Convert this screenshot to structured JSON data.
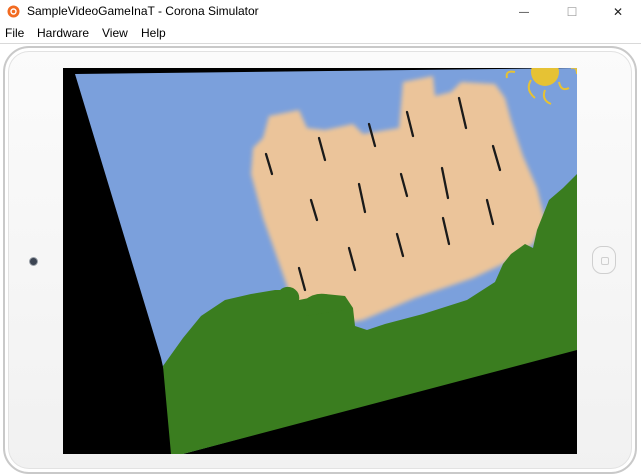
{
  "window": {
    "title": "SampleVideoGameInaT - Corona Simulator",
    "minimize_glyph": "—",
    "maximize_glyph": "☐",
    "close_glyph": "✕"
  },
  "menu": {
    "items": [
      {
        "label": "File"
      },
      {
        "label": "Hardware"
      },
      {
        "label": "View"
      },
      {
        "label": "Help"
      }
    ]
  },
  "colors": {
    "sky": "#7ba0dc",
    "castle": "#ebc49a",
    "grass": "#3a7d1f",
    "sun": "#e6c234",
    "background": "#000000"
  },
  "icons": {
    "app": "corona-app-icon",
    "camera": "camera-icon",
    "home": "home-button-icon"
  }
}
